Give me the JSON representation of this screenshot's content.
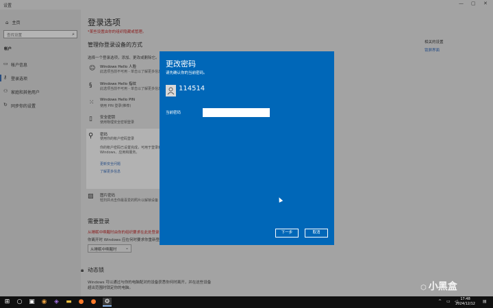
{
  "window": {
    "title": "设置",
    "controls": [
      "minimize-icon",
      "maximize-icon",
      "close-icon"
    ]
  },
  "sidebar": {
    "home": "主页",
    "search_placeholder": "查找设置",
    "section": "帐户",
    "items": [
      {
        "label": "帐户信息",
        "icon": "person-card-icon"
      },
      {
        "label": "登录选项",
        "icon": "key-icon",
        "active": true
      },
      {
        "label": "家庭和其他用户",
        "icon": "people-icon"
      },
      {
        "label": "同步你的设置",
        "icon": "sync-icon"
      }
    ]
  },
  "main": {
    "title": "登录选项",
    "warning": "*某些设置由你的组织隐藏或管理。",
    "manage_heading": "管理你登录设备的方式",
    "manage_desc": "选择一个登录选项，添加、更改或删除它。",
    "options": [
      {
        "title": "Windows Hello 人脸",
        "desc": "此选项当前不可用 - 单击以了解更多信息",
        "icon": "face-icon"
      },
      {
        "title": "Windows Hello 指纹",
        "desc": "此选项当前不可用 - 单击以了解更多信息",
        "icon": "fingerprint-icon"
      },
      {
        "title": "Windows Hello PIN",
        "desc": "使用 PIN 登录(推荐)",
        "icon": "pin-keypad-icon"
      },
      {
        "title": "安全密钥",
        "desc": "使用物理安全密钥登录",
        "icon": "usb-key-icon"
      }
    ],
    "password": {
      "title": "密码",
      "desc": "使用你的帐户密码登录",
      "detail": "你的帐户密码已设置完成，可用于登录到 Windows、应用和服务。",
      "link_security": "更新安全问题",
      "link_learn": "了解更多信息"
    },
    "picture_password": {
      "title": "图片密码",
      "desc": "轻扫并点击你最喜爱的照片以解锁设备"
    },
    "require_heading": "需要登录",
    "require_warn1": "从睡眠中唤醒时由你的组织要求在此处登录",
    "require_desc": "你离开时 Windows 应在何时要求你重新登录?",
    "require_value": "从睡眠中唤醒时",
    "dynamic_heading": "动态锁",
    "dynamic_desc1": "Windows 可以通过与你的电脑配对的设备获悉你何时离开，并在这些设备",
    "dynamic_desc2": "超出范围时锁定你的电脑。",
    "related_title": "相关的设置",
    "related_link": "锁屏界面"
  },
  "dialog": {
    "title": "更改密码",
    "subtitle": "请先确认你的当前密码。",
    "username": "114514",
    "current_label": "当前密码",
    "current_value": "",
    "next": "下一步",
    "cancel": "取消"
  },
  "taskbar": {
    "time": "17:48",
    "date": "2024/12/12",
    "icons": [
      "windows-start-icon",
      "search-icon",
      "task-view-icon",
      "app-icon",
      "app-icon",
      "file-explorer-icon",
      "firefox-icon",
      "firefox-icon",
      "terminal-icon",
      "settings-icon"
    ]
  },
  "watermark": "小黑盒"
}
